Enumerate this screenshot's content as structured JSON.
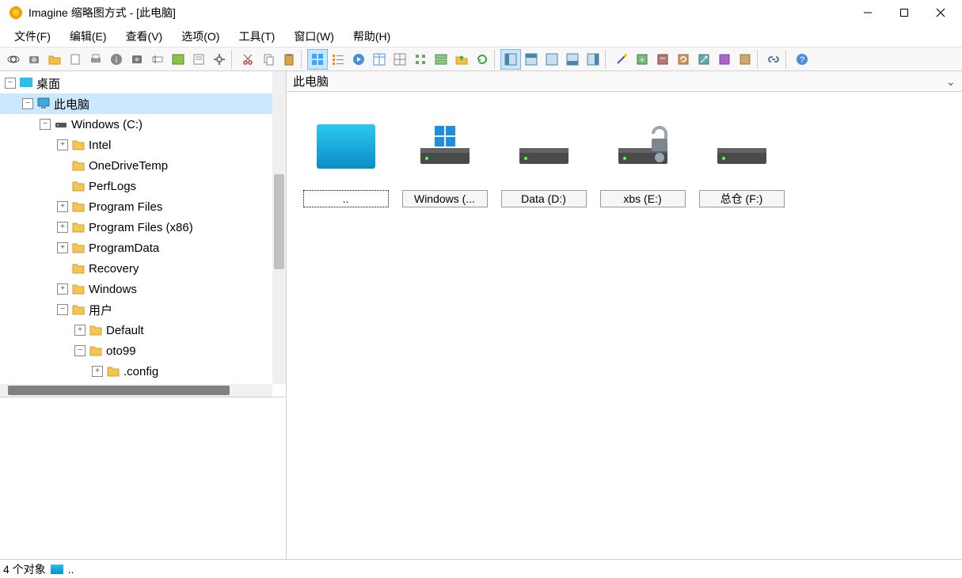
{
  "window": {
    "title": "Imagine 缩略图方式 - [此电脑]"
  },
  "menu": {
    "file": "文件(F)",
    "edit": "编辑(E)",
    "view": "查看(V)",
    "options": "选项(O)",
    "tools": "工具(T)",
    "window": "窗口(W)",
    "help": "帮助(H)"
  },
  "toolbar_icons": [
    "eye-icon",
    "camera-icon",
    "folder-open-icon",
    "new-icon",
    "print-icon",
    "info-icon",
    "screenshot-icon",
    "rename-icon",
    "wallpaper-icon",
    "properties-icon",
    "settings-gear-icon",
    "sep",
    "cut-icon",
    "copy-icon",
    "paste-icon",
    "sep",
    "view-thumb-icon",
    "view-list-icon",
    "slideshow-icon",
    "view-detail-icon",
    "view-grid-icon",
    "view-small-icon",
    "view-tiles-icon",
    "up-folder-icon",
    "refresh-icon",
    "sep",
    "pane-1-icon",
    "pane-2-icon",
    "pane-3-icon",
    "pane-4-icon",
    "pane-5-icon",
    "sep",
    "tool-wand-icon",
    "zoom-in-icon",
    "zoom-out-icon",
    "rotate-icon",
    "resize-icon",
    "color-icon",
    "effects-icon",
    "sep",
    "link-icon",
    "sep",
    "help-icon"
  ],
  "tree": [
    {
      "level": 0,
      "tw": "-",
      "icon": "desktop",
      "label": "桌面"
    },
    {
      "level": 1,
      "tw": "-",
      "icon": "pc",
      "label": "此电脑",
      "selected": true
    },
    {
      "level": 2,
      "tw": "-",
      "icon": "drive",
      "label": "Windows (C:)"
    },
    {
      "level": 3,
      "tw": "+",
      "icon": "folder",
      "label": "Intel"
    },
    {
      "level": 3,
      "tw": " ",
      "icon": "folder",
      "label": "OneDriveTemp"
    },
    {
      "level": 3,
      "tw": " ",
      "icon": "folder",
      "label": "PerfLogs"
    },
    {
      "level": 3,
      "tw": "+",
      "icon": "folder",
      "label": "Program Files"
    },
    {
      "level": 3,
      "tw": "+",
      "icon": "folder",
      "label": "Program Files (x86)"
    },
    {
      "level": 3,
      "tw": "+",
      "icon": "folder",
      "label": "ProgramData"
    },
    {
      "level": 3,
      "tw": " ",
      "icon": "folder",
      "label": "Recovery"
    },
    {
      "level": 3,
      "tw": "+",
      "icon": "folder",
      "label": "Windows"
    },
    {
      "level": 3,
      "tw": "-",
      "icon": "folder",
      "label": "用户"
    },
    {
      "level": 4,
      "tw": "+",
      "icon": "folder",
      "label": "Default"
    },
    {
      "level": 4,
      "tw": "-",
      "icon": "folder",
      "label": "oto99"
    },
    {
      "level": 5,
      "tw": "+",
      "icon": "folder",
      "label": ".config"
    }
  ],
  "current_path": "此电脑",
  "items": [
    {
      "icon": "desktop-big",
      "label": "..",
      "selected": true
    },
    {
      "icon": "drive-win",
      "label": "Windows (..."
    },
    {
      "icon": "drive",
      "label": "Data (D:)"
    },
    {
      "icon": "drive-lock",
      "label": "xbs (E:)"
    },
    {
      "icon": "drive",
      "label": "总仓 (F:)"
    }
  ],
  "status": {
    "count": "4 个对象",
    "path": ".."
  }
}
